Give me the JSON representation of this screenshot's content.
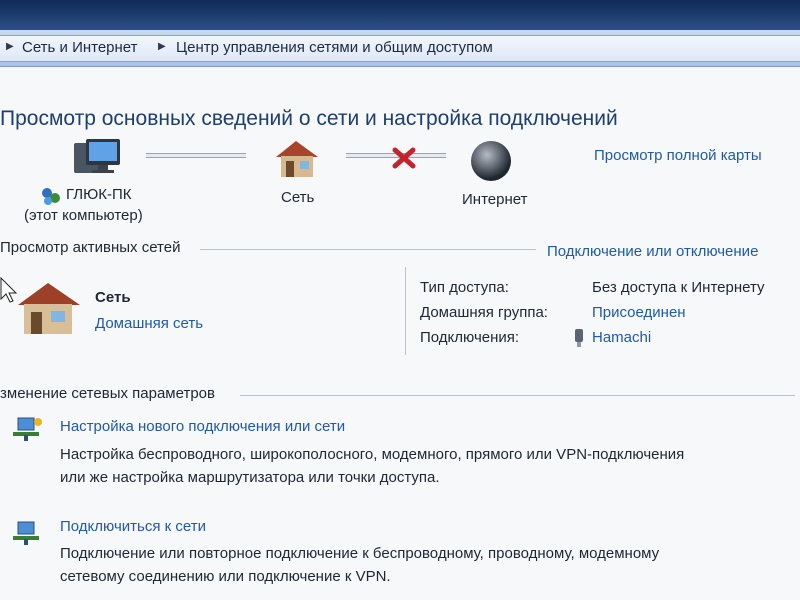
{
  "breadcrumb": {
    "item1": "Сеть и Интернет",
    "item2": "Центр управления сетями и общим доступом"
  },
  "page": {
    "title": "Просмотр основных сведений о сети и настройка подключений",
    "full_map_link": "Просмотр полной карты"
  },
  "network_map": {
    "computer_name": "ГЛЮК-ПК",
    "computer_sub": "(этот компьютер)",
    "network_label": "Сеть",
    "internet_label": "Интернет"
  },
  "active_networks": {
    "header": "Просмотр активных сетей",
    "connect_link": "Подключение или отключение",
    "network_name": "Сеть",
    "network_type": "Домашняя сеть",
    "props": [
      {
        "label": "Тип доступа:",
        "value": "Без доступа к Интернету"
      },
      {
        "label": "Домашняя группа:",
        "value": "Присоединен"
      },
      {
        "label": "Подключения:",
        "value": "Hamachi"
      }
    ]
  },
  "change_settings": {
    "header": "зменение сетевых параметров",
    "items": [
      {
        "title": "Настройка нового подключения или сети",
        "line1": "Настройка беспроводного, широкополосного, модемного, прямого или VPN-подключения",
        "line2": "или же настройка маршрутизатора или точки доступа."
      },
      {
        "title": "Подключиться к сети",
        "line1": "Подключение или повторное подключение к беспроводному, проводному, модемному",
        "line2": "сетевому соединению или подключение к VPN."
      }
    ]
  }
}
